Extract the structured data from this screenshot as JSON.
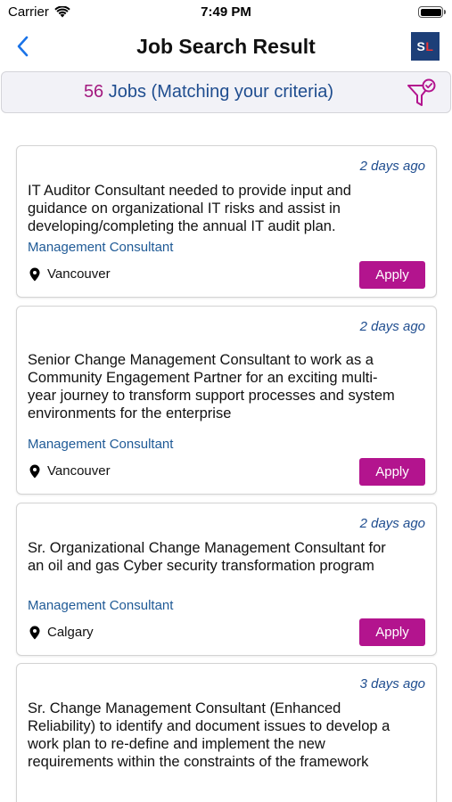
{
  "status_bar": {
    "carrier": "Carrier",
    "time": "7:49 PM"
  },
  "nav": {
    "title": "Job Search Result",
    "logo_text": "S",
    "logo_accent": "L"
  },
  "results": {
    "count": "56",
    "label": "Jobs (Matching your criteria)"
  },
  "colors": {
    "accent": "#b3148e",
    "primary_blue": "#1f4d8f",
    "logo_bg": "#1d3f78"
  },
  "jobs": [
    {
      "posted": "2 days ago",
      "title": "IT Auditor Consultant needed to provide input and guidance on organizational IT risks and assist in developing/completing the annual IT audit plan.",
      "category": "Management Consultant",
      "location": "Vancouver",
      "apply_label": "Apply"
    },
    {
      "posted": "2 days ago",
      "title": "Senior Change Management Consultant to work as a Community Engagement Partner for an exciting multi-year journey to transform  support processes and system environments for the enterprise",
      "category": "Management Consultant",
      "location": "Vancouver",
      "apply_label": "Apply"
    },
    {
      "posted": "2 days ago",
      "title": "Sr. Organizational Change Management Consultant for an oil and gas Cyber security transformation program",
      "category": "Management Consultant",
      "location": "Calgary",
      "apply_label": "Apply"
    },
    {
      "posted": "3 days ago",
      "title": "Sr. Change Management Consultant (Enhanced Reliability) to identify and document issues to develop a work plan to re-define and implement the new requirements within the constraints of the framework"
    }
  ]
}
